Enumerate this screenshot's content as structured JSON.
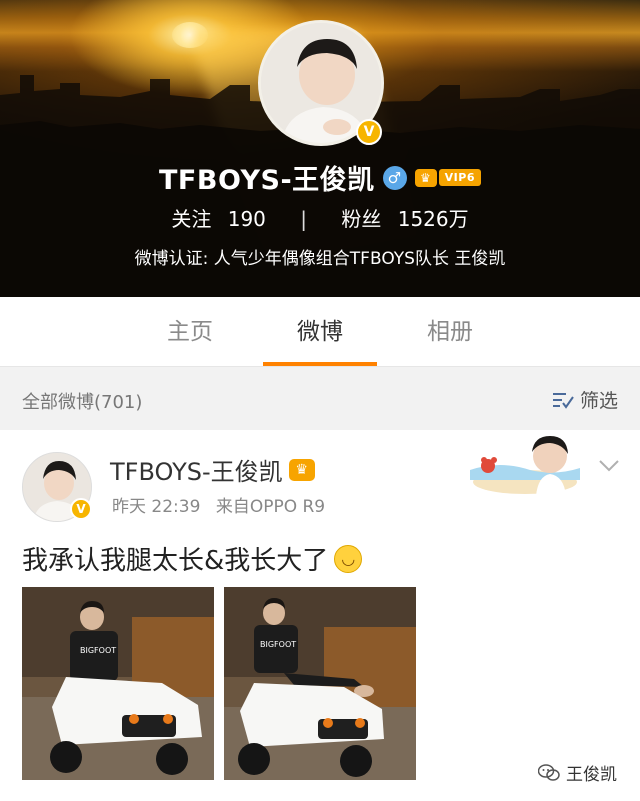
{
  "profile": {
    "name": "TFBOYS-王俊凯",
    "vip_label": "VIP6",
    "following_label": "关注",
    "following_count": "190",
    "followers_label": "粉丝",
    "followers_count": "1526万",
    "verification": "微博认证: 人气少年偶像组合TFBOYS队长 王俊凯",
    "verified_badge": "V",
    "gender_symbol": "♂"
  },
  "tabs": [
    {
      "label": "主页",
      "active": false
    },
    {
      "label": "微博",
      "active": true
    },
    {
      "label": "相册",
      "active": false
    }
  ],
  "filter": {
    "count_text": "全部微博(701)",
    "filter_label": "筛选"
  },
  "post": {
    "author": "TFBOYS-王俊凯",
    "time": "昨天 22:39",
    "source_prefix": "来自",
    "source": "OPPO R9",
    "text": "我承认我腿太长&我长大了"
  },
  "watermark": "王俊凯",
  "colors": {
    "accent": "#ff8200",
    "vip": "#f5a300",
    "gender": "#5aa7e8"
  },
  "icons": [
    "verified-badge-icon",
    "male-icon",
    "vip-crown-icon",
    "filter-icon",
    "chevron-down-icon",
    "smile-emoji-icon",
    "wechat-icon"
  ]
}
